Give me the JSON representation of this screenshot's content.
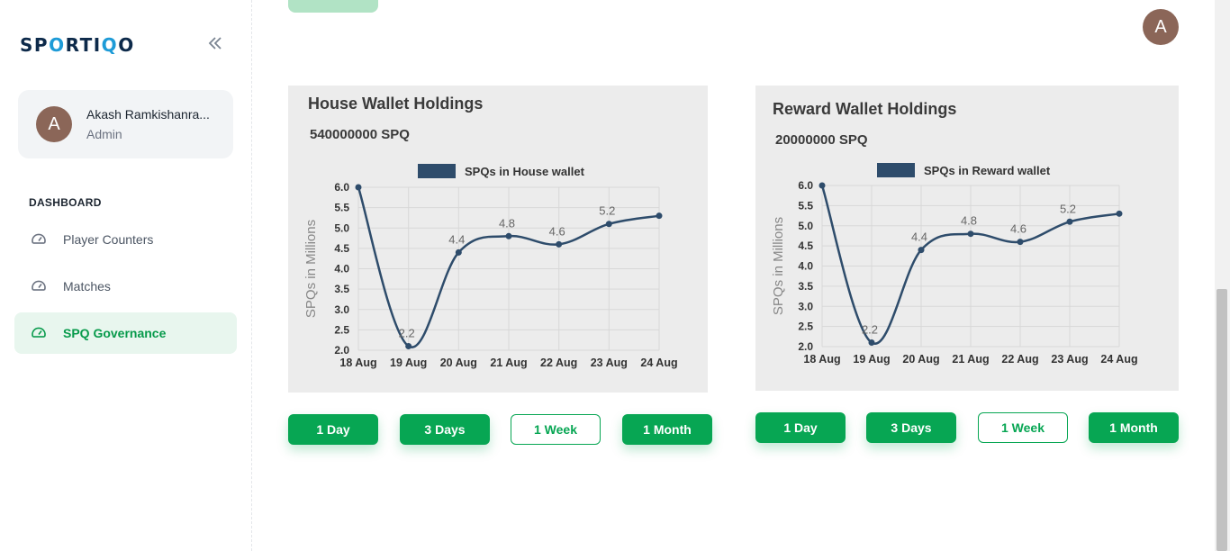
{
  "brand": {
    "logo_pre": "SP",
    "logo_mark": "O",
    "logo_mid": "RTI",
    "logo_mark2": "Q",
    "logo_post": "O"
  },
  "user": {
    "initial": "A",
    "name": "Akash Ramkishanra...",
    "role": "Admin"
  },
  "sidebar": {
    "section_title": "DASHBOARD",
    "items": [
      {
        "label": "Player Counters",
        "icon": "gauge-icon",
        "active": false
      },
      {
        "label": "Matches",
        "icon": "gauge-icon",
        "active": false
      },
      {
        "label": "SPQ Governance",
        "icon": "gauge-icon",
        "active": true
      }
    ]
  },
  "header": {
    "avatar_initial": "A"
  },
  "colors": {
    "accent": "#07a653",
    "line": "#2e4c6b",
    "avatar": "#8b6658"
  },
  "cards": [
    {
      "title": "House Wallet Holdings",
      "amount": "540000000 SPQ",
      "buttons": [
        "1 Day",
        "3 Days",
        "1 Week",
        "1 Month"
      ],
      "selected_button": "1 Week"
    },
    {
      "title": "Reward Wallet Holdings",
      "amount": "20000000 SPQ",
      "buttons": [
        "1 Day",
        "3 Days",
        "1 Week",
        "1 Month"
      ],
      "selected_button": "1 Week"
    }
  ],
  "chart_data": [
    {
      "type": "line",
      "legend": "SPQs in House wallet",
      "ylabel": "SPQs in Millions",
      "categories": [
        "18 Aug",
        "19 Aug",
        "20 Aug",
        "21 Aug",
        "22 Aug",
        "23 Aug",
        "24 Aug"
      ],
      "series": [
        {
          "name": "SPQs in House wallet",
          "values": [
            6.0,
            2.1,
            4.4,
            4.8,
            4.6,
            5.1,
            5.3
          ]
        }
      ],
      "data_labels": [
        "",
        "2.2",
        "4.4",
        "4.8",
        "4.6",
        "5.2",
        ""
      ],
      "ylim": [
        2.0,
        6.0
      ],
      "yticks": [
        "2.0",
        "2.5",
        "3.0",
        "3.5",
        "4.0",
        "4.5",
        "5.0",
        "5.5",
        "6.0"
      ],
      "grid": true,
      "legend_position": "top"
    },
    {
      "type": "line",
      "legend": "SPQs in Reward wallet",
      "ylabel": "SPQs in Millions",
      "categories": [
        "18 Aug",
        "19 Aug",
        "20 Aug",
        "21 Aug",
        "22 Aug",
        "23 Aug",
        "24 Aug"
      ],
      "series": [
        {
          "name": "SPQs in Reward wallet",
          "values": [
            6.0,
            2.1,
            4.4,
            4.8,
            4.6,
            5.1,
            5.3
          ]
        }
      ],
      "data_labels": [
        "",
        "2.2",
        "4.4",
        "4.8",
        "4.6",
        "5.2",
        ""
      ],
      "ylim": [
        2.0,
        6.0
      ],
      "yticks": [
        "2.0",
        "2.5",
        "3.0",
        "3.5",
        "4.0",
        "4.5",
        "5.0",
        "5.5",
        "6.0"
      ],
      "grid": true,
      "legend_position": "top"
    }
  ]
}
